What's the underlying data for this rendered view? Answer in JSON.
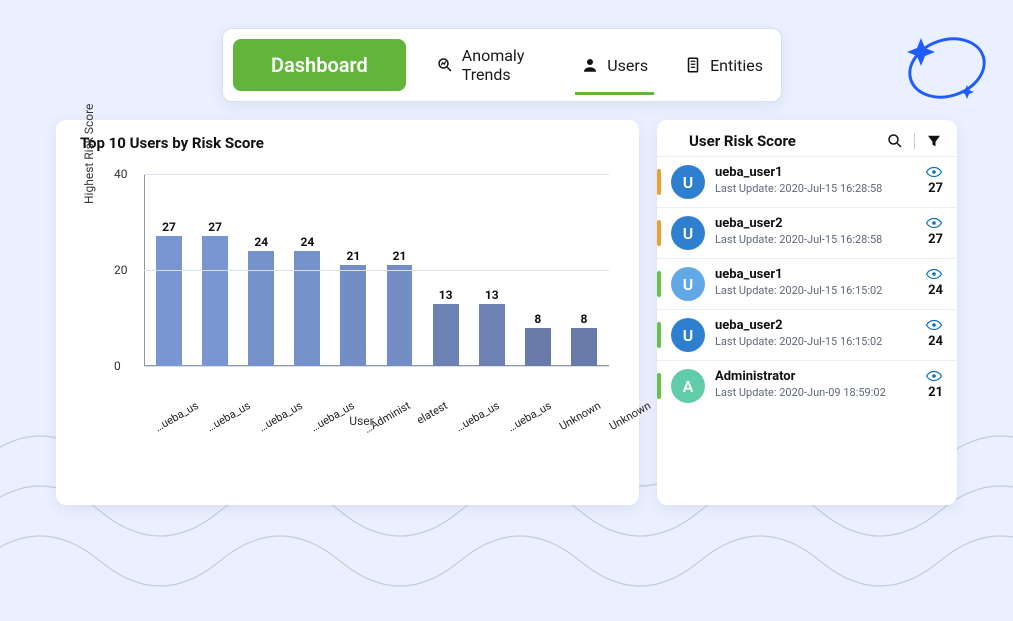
{
  "tabs": {
    "dashboard": "Dashboard",
    "anomaly": "Anomaly Trends",
    "users": "Users",
    "entities": "Entities"
  },
  "chart_card": {
    "title": "Top 10 Users by Risk Score"
  },
  "risk_card": {
    "title": "User Risk Score"
  },
  "chart_data": {
    "type": "bar",
    "title": "Top 10 Users by Risk Score",
    "xlabel": "User",
    "ylabel": "Highest Risk Score",
    "ylim": [
      0,
      40
    ],
    "yticks": [
      0,
      20,
      40
    ],
    "categories": [
      "ueba_us…",
      "ueba_us…",
      "ueba_us…",
      "ueba_us…",
      "Administ…",
      "elatest",
      "ueba_us…",
      "ueba_us…",
      "Unknown",
      "Unknown"
    ],
    "values": [
      27,
      27,
      24,
      24,
      21,
      21,
      13,
      13,
      8,
      8
    ]
  },
  "risk_list": [
    {
      "initial": "U",
      "name": "ueba_user1",
      "sub": "Last Update: 2020-Jul-15 16:28:58",
      "score": 27,
      "avatar": "#2f7fd1",
      "accent": "#e8a12f"
    },
    {
      "initial": "U",
      "name": "ueba_user2",
      "sub": "Last Update: 2020-Jul-15 16:28:58",
      "score": 27,
      "avatar": "#2f7fd1",
      "accent": "#e8a12f"
    },
    {
      "initial": "U",
      "name": "ueba_user1",
      "sub": "Last Update: 2020-Jul-15 16:15:02",
      "score": 24,
      "avatar": "#62a7e6",
      "accent": "#66c24a"
    },
    {
      "initial": "U",
      "name": "ueba_user2",
      "sub": "Last Update: 2020-Jul-15 16:15:02",
      "score": 24,
      "avatar": "#2f7fd1",
      "accent": "#66c24a"
    },
    {
      "initial": "A",
      "name": "Administrator",
      "sub": "Last Update: 2020-Jun-09 18:59:02",
      "score": 21,
      "avatar": "#62cba9",
      "accent": "#66c24a"
    }
  ]
}
